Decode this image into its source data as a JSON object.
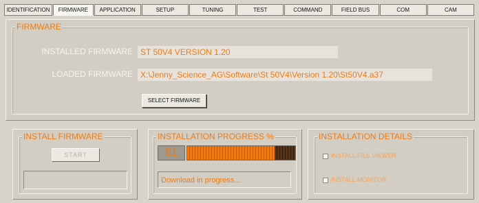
{
  "tabs": [
    {
      "label": "IDENTIFICATION",
      "active": false
    },
    {
      "label": "FIRMWARE",
      "active": true
    },
    {
      "label": "APPLICATION",
      "active": false
    },
    {
      "label": "SETUP",
      "active": false
    },
    {
      "label": "TUNING",
      "active": false
    },
    {
      "label": "TEST",
      "active": false
    },
    {
      "label": "COMMAND",
      "active": false
    },
    {
      "label": "FIELD BUS",
      "active": false
    },
    {
      "label": "COM",
      "active": false
    },
    {
      "label": "CAM",
      "active": false
    }
  ],
  "firmware": {
    "legend": "FIRMWARE",
    "installed_label": "INSTALLED FIRMWARE",
    "installed_value": "ST 50V4  VERSION 1.20",
    "loaded_label": "LOADED FIRMWARE",
    "loaded_value": "X:\\Jenny_Science_AG\\Software\\St 50V4\\Version 1.20\\St50V4.a37",
    "select_button": "SELECT FIRMWARE"
  },
  "install": {
    "legend": "INSTALL FIRMWARE",
    "start_button": "START"
  },
  "progress": {
    "legend": "INSTALLATION PROGRESS %",
    "percent": 81,
    "percent_label": "81",
    "status": "Download in progress...",
    "bar_color": "#f07a12"
  },
  "details": {
    "legend": "INSTALLATION DETAILS",
    "options": [
      {
        "label": "INSTALL FILE VIEWER",
        "checked": false
      },
      {
        "label": "INSTALL MONITOR",
        "checked": false
      }
    ]
  },
  "colors": {
    "accent": "#f07a12",
    "panel": "#d3cec4"
  }
}
